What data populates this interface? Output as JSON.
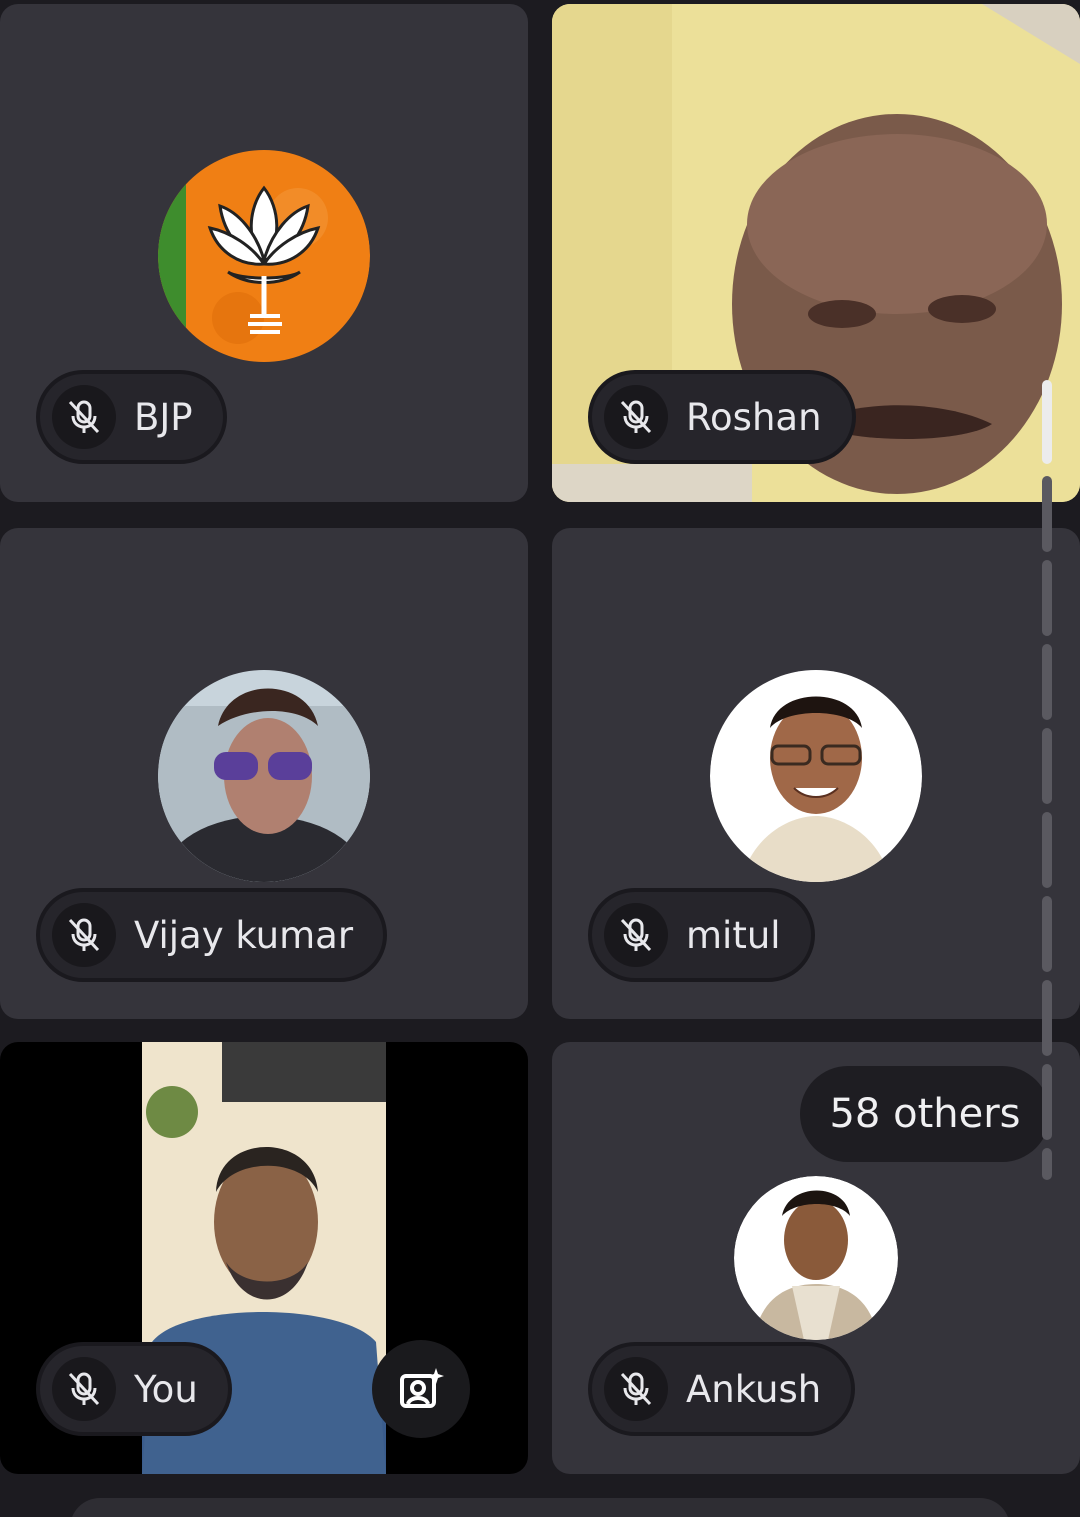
{
  "participants": [
    {
      "name": "BJP",
      "muted": true,
      "media": "avatar"
    },
    {
      "name": "Roshan",
      "muted": true,
      "media": "video"
    },
    {
      "name": "Vijay kumar",
      "muted": true,
      "media": "avatar"
    },
    {
      "name": "mitul",
      "muted": true,
      "media": "avatar"
    },
    {
      "name": "You",
      "muted": true,
      "media": "video"
    },
    {
      "name": "Ankush",
      "muted": true,
      "media": "avatar"
    }
  ],
  "others_label": "58 others",
  "icons": {
    "mute": "mic-off-icon",
    "effects": "camera-effects-icon"
  },
  "colors": {
    "background": "#1c1b20",
    "tile": "#35343b",
    "pill": "#26252b",
    "text": "#e8e8ec"
  }
}
